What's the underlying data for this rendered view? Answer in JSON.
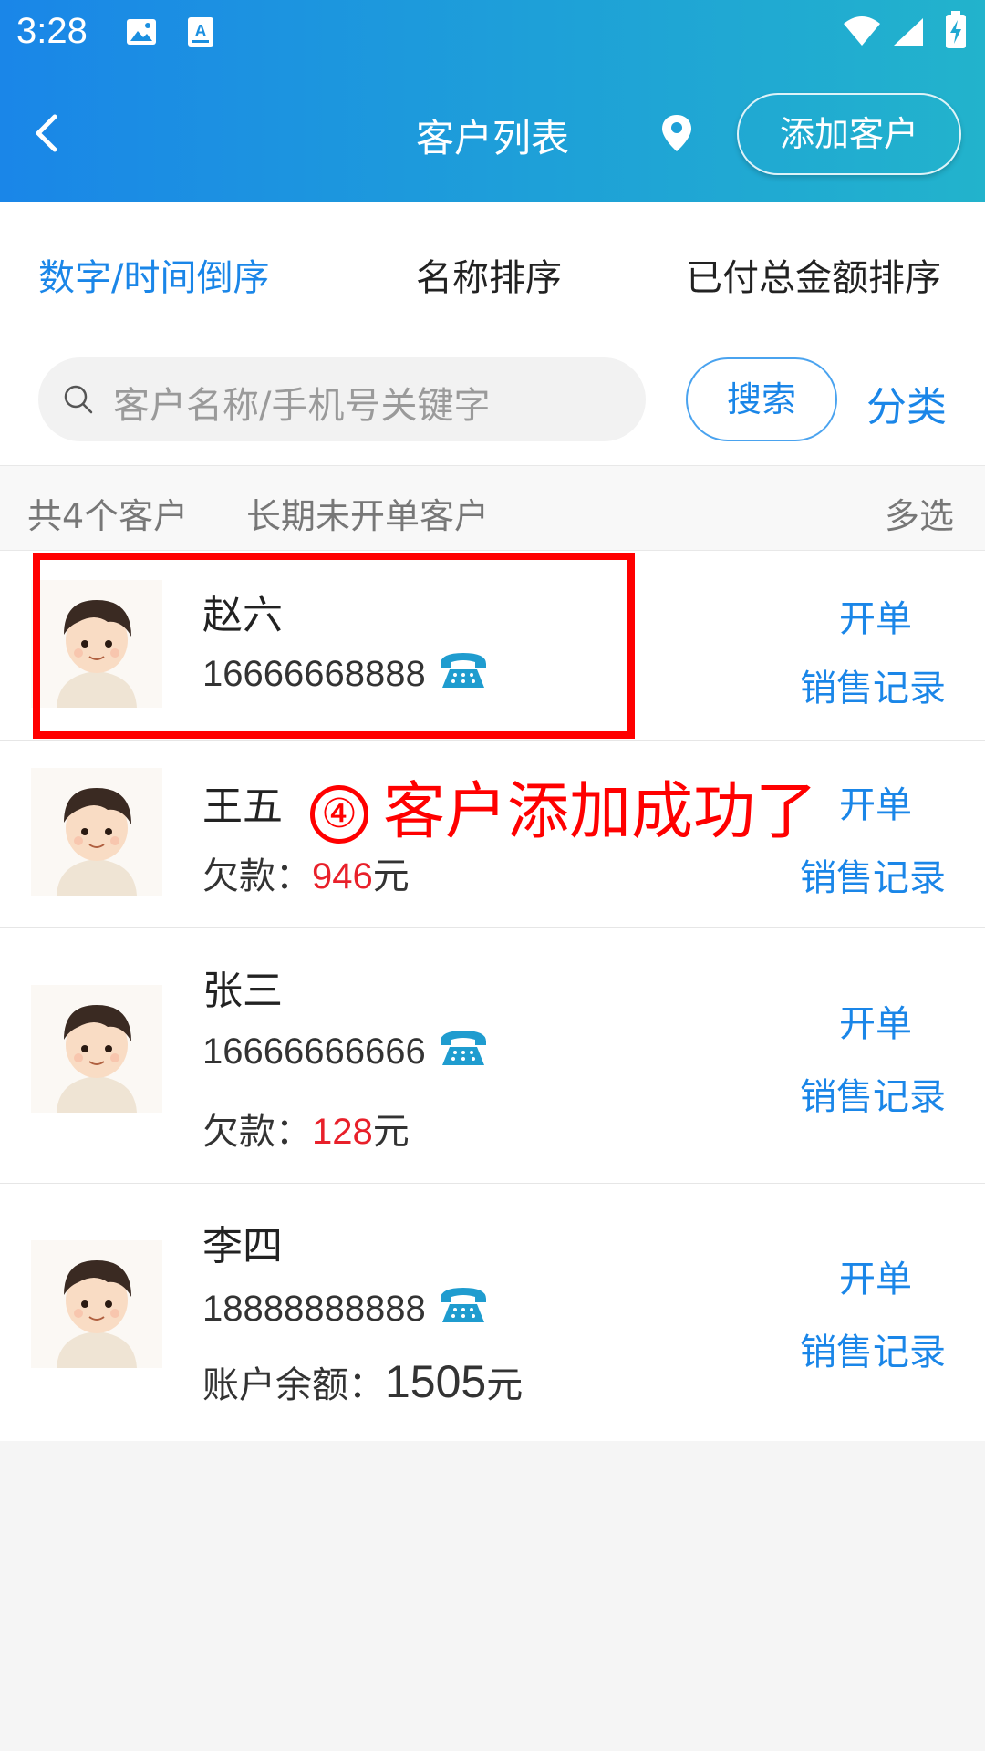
{
  "status_bar": {
    "time": "3:28"
  },
  "header": {
    "title": "客户列表",
    "add_button_label": "添加客户",
    "back_icon": "chevron-left-icon",
    "location_icon": "location-pin-icon"
  },
  "sort_tabs": [
    {
      "label": "数字/时间倒序",
      "active": true
    },
    {
      "label": "名称排序",
      "active": false
    },
    {
      "label": "已付总金额排序",
      "active": false
    }
  ],
  "search": {
    "placeholder": "客户名称/手机号关键字",
    "button_label": "搜索",
    "category_label": "分类"
  },
  "summary": {
    "count_text": "共4个客户",
    "inactive_filter": "长期未开单客户",
    "multi_select": "多选"
  },
  "customers": [
    {
      "name": "赵六",
      "phone": "16666668888",
      "open_label": "开单",
      "sales_label": "销售记录"
    },
    {
      "name": "王五",
      "debt_label": "欠款：",
      "debt_value": "946",
      "unit": "元",
      "open_label": "开单",
      "sales_label": "销售记录"
    },
    {
      "name": "张三",
      "phone": "16666666666",
      "debt_label": "欠款：",
      "debt_value": "128",
      "unit": "元",
      "open_label": "开单",
      "sales_label": "销售记录"
    },
    {
      "name": "李四",
      "phone": "18888888888",
      "balance_label": "账户余额：",
      "balance_value": "1505",
      "unit": "元",
      "open_label": "开单",
      "sales_label": "销售记录"
    }
  ],
  "annotation": {
    "step": "④",
    "text": "客户添加成功了"
  },
  "colors": {
    "accent": "#1a86e8",
    "header_gradient_start": "#1a86e8",
    "header_gradient_end": "#22b3cc",
    "debt_red": "#e8202a",
    "annotation_red": "#ff0000"
  }
}
